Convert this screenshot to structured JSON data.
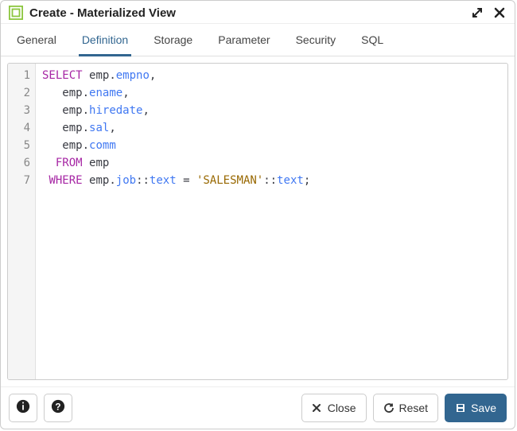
{
  "header": {
    "title": "Create - Materialized View"
  },
  "tabs": [
    {
      "label": "General"
    },
    {
      "label": "Definition"
    },
    {
      "label": "Storage"
    },
    {
      "label": "Parameter"
    },
    {
      "label": "Security"
    },
    {
      "label": "SQL"
    }
  ],
  "active_tab_index": 1,
  "editor": {
    "lines": [
      {
        "n": 1,
        "tokens": [
          [
            "kw",
            "SELECT"
          ],
          [
            "op",
            " "
          ],
          [
            "ident",
            "emp"
          ],
          [
            "op",
            "."
          ],
          [
            "prop",
            "empno"
          ],
          [
            "op",
            ","
          ]
        ]
      },
      {
        "n": 2,
        "tokens": [
          [
            "op",
            "   "
          ],
          [
            "ident",
            "emp"
          ],
          [
            "op",
            "."
          ],
          [
            "prop",
            "ename"
          ],
          [
            "op",
            ","
          ]
        ]
      },
      {
        "n": 3,
        "tokens": [
          [
            "op",
            "   "
          ],
          [
            "ident",
            "emp"
          ],
          [
            "op",
            "."
          ],
          [
            "prop",
            "hiredate"
          ],
          [
            "op",
            ","
          ]
        ]
      },
      {
        "n": 4,
        "tokens": [
          [
            "op",
            "   "
          ],
          [
            "ident",
            "emp"
          ],
          [
            "op",
            "."
          ],
          [
            "prop",
            "sal"
          ],
          [
            "op",
            ","
          ]
        ]
      },
      {
        "n": 5,
        "tokens": [
          [
            "op",
            "   "
          ],
          [
            "ident",
            "emp"
          ],
          [
            "op",
            "."
          ],
          [
            "prop",
            "comm"
          ]
        ]
      },
      {
        "n": 6,
        "tokens": [
          [
            "op",
            "  "
          ],
          [
            "kw",
            "FROM"
          ],
          [
            "op",
            " "
          ],
          [
            "ident",
            "emp"
          ]
        ]
      },
      {
        "n": 7,
        "tokens": [
          [
            "op",
            " "
          ],
          [
            "kw",
            "WHERE"
          ],
          [
            "op",
            " "
          ],
          [
            "ident",
            "emp"
          ],
          [
            "op",
            "."
          ],
          [
            "prop",
            "job"
          ],
          [
            "op",
            "::"
          ],
          [
            "prop",
            "text"
          ],
          [
            "op",
            " = "
          ],
          [
            "str",
            "'SALESMAN'"
          ],
          [
            "op",
            "::"
          ],
          [
            "prop",
            "text"
          ],
          [
            "op",
            ";"
          ]
        ]
      }
    ]
  },
  "footer": {
    "close_label": "Close",
    "reset_label": "Reset",
    "save_label": "Save"
  }
}
